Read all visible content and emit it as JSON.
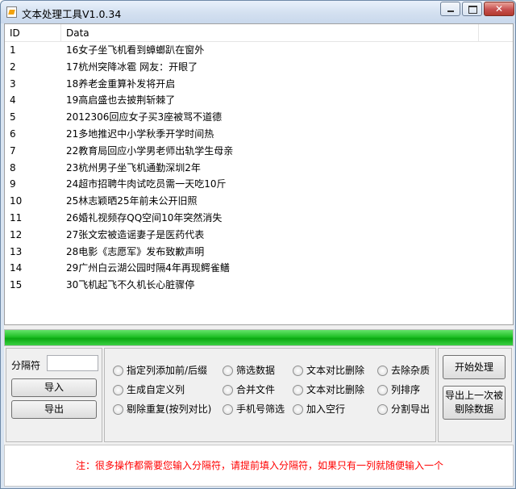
{
  "window": {
    "title": "文本处理工具V1.0.34",
    "close_glyph": "✕"
  },
  "table": {
    "headers": {
      "id": "ID",
      "data": "Data"
    },
    "rows": [
      {
        "id": "1",
        "data": "16女子坐飞机看到蟑螂趴在窗外"
      },
      {
        "id": "2",
        "data": "17杭州突降冰雹 网友：开眼了"
      },
      {
        "id": "3",
        "data": "18养老金重算补发将开启"
      },
      {
        "id": "4",
        "data": "19高启盛也去披荆斩棘了"
      },
      {
        "id": "5",
        "data": "2012306回应女子买3座被骂不道德"
      },
      {
        "id": "6",
        "data": "21多地推迟中小学秋季开学时间热"
      },
      {
        "id": "7",
        "data": "22教育局回应小学男老师出轨学生母亲"
      },
      {
        "id": "8",
        "data": "23杭州男子坐飞机通勤深圳2年"
      },
      {
        "id": "9",
        "data": "24超市招聘牛肉试吃员需一天吃10斤"
      },
      {
        "id": "10",
        "data": "25林志颖晒25年前未公开旧照"
      },
      {
        "id": "11",
        "data": "26婚礼视频存QQ空间10年突然消失"
      },
      {
        "id": "12",
        "data": "27张文宏被造谣妻子是医药代表"
      },
      {
        "id": "13",
        "data": "28电影《志愿军》发布致歉声明"
      },
      {
        "id": "14",
        "data": "29广州白云湖公园时隔4年再现鳄雀鳝"
      },
      {
        "id": "15",
        "data": "30飞机起飞不久机长心脏骤停"
      }
    ]
  },
  "progress": {
    "percent": 100,
    "color": "#1fbf26"
  },
  "left_panel": {
    "separator_label": "分隔符",
    "separator_value": "",
    "import_label": "导入",
    "export_label": "导出"
  },
  "options": [
    {
      "label": "指定列添加前/后缀"
    },
    {
      "label": "筛选数据"
    },
    {
      "label": "文本对比删除"
    },
    {
      "label": "去除杂质"
    },
    {
      "label": "生成自定义列"
    },
    {
      "label": "合并文件"
    },
    {
      "label": "文本对比删除"
    },
    {
      "label": "列排序"
    },
    {
      "label": "剔除重复(按列对比)"
    },
    {
      "label": "手机号筛选"
    },
    {
      "label": "加入空行"
    },
    {
      "label": "分割导出"
    }
  ],
  "right_panel": {
    "start_label": "开始处理",
    "export_prev_line1": "导出上一次被",
    "export_prev_line2": "剔除数据"
  },
  "note": "注：很多操作都需要您输入分隔符，请提前填入分隔符，如果只有一列就随便输入一个",
  "note_color": "#ff0000"
}
